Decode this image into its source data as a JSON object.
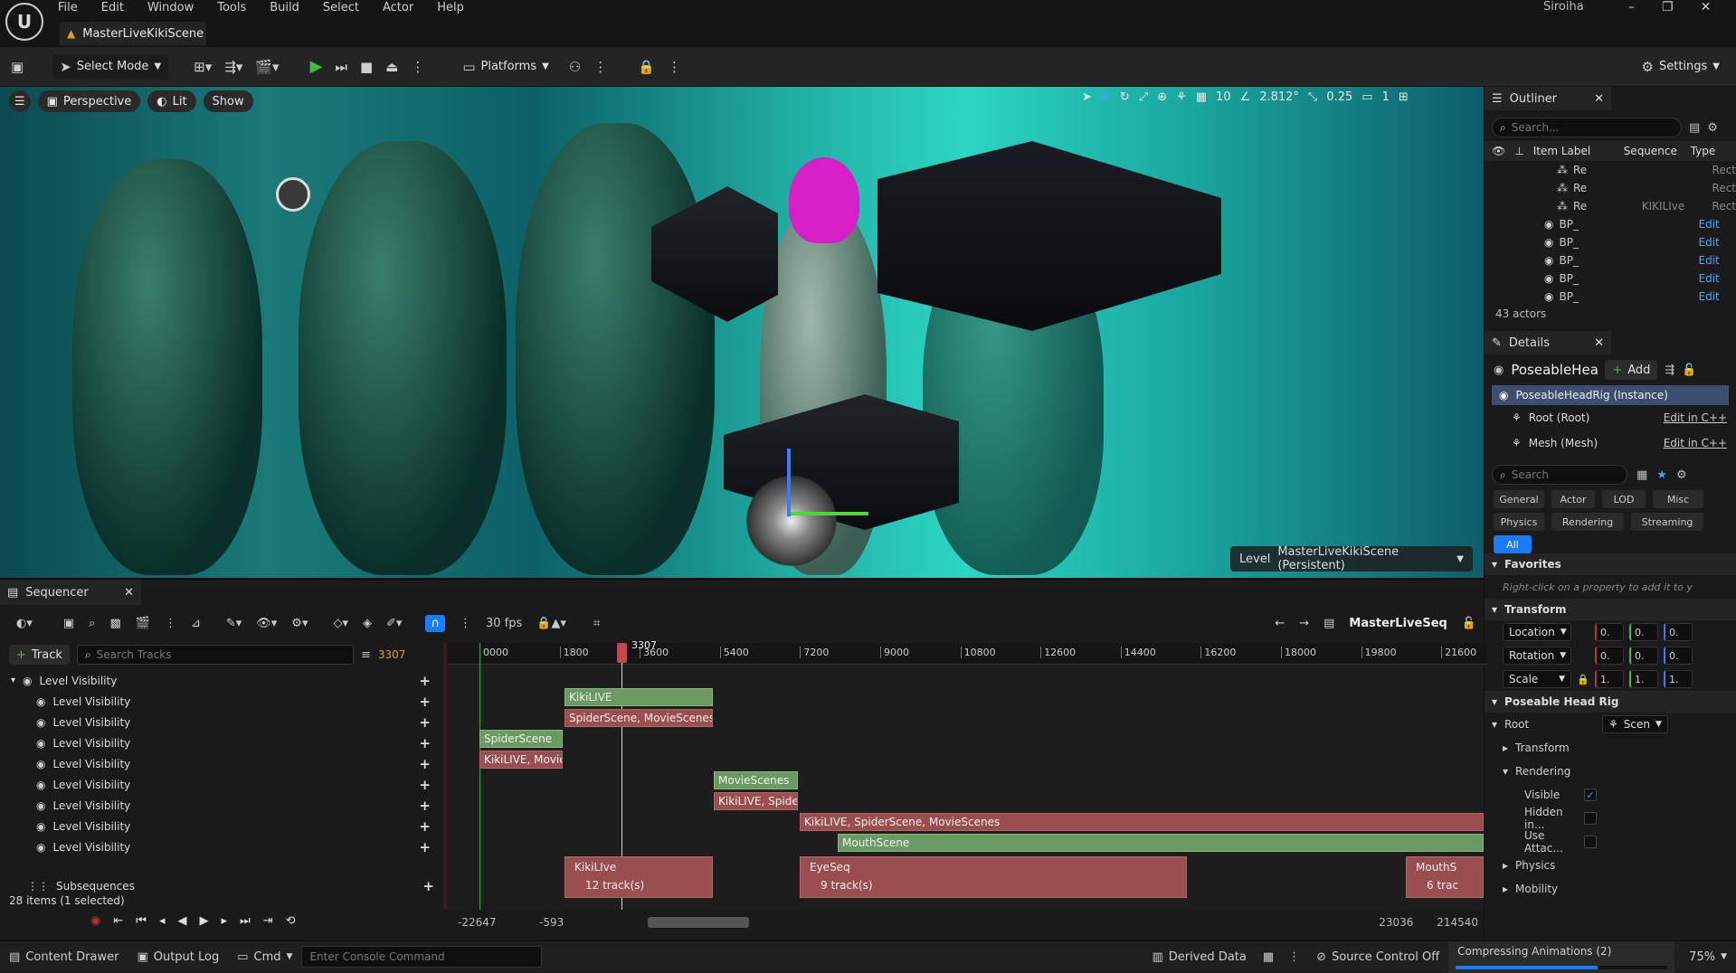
{
  "app": {
    "logo": "U",
    "document_tab": "MasterLiveKikiScene",
    "user": "Siroiha"
  },
  "menu": [
    "File",
    "Edit",
    "Window",
    "Tools",
    "Build",
    "Select",
    "Actor",
    "Help"
  ],
  "window_controls": [
    "–",
    "❐",
    "✕"
  ],
  "toolbar": {
    "select_mode": "Select Mode",
    "platforms": "Platforms",
    "settings": "Settings"
  },
  "viewport": {
    "perspective": "Perspective",
    "lit": "Lit",
    "show": "Show",
    "grid": "10",
    "angle": "2.812°",
    "scale": "0.25",
    "camera_speed": "1",
    "level_label": "Level",
    "level_name": "MasterLiveKikiScene (Persistent)"
  },
  "outliner": {
    "title": "Outliner",
    "search_placeholder": "Search...",
    "columns": {
      "label": "Item Label",
      "sequence": "Sequence",
      "type": "Type"
    },
    "rows": [
      {
        "name": "Re",
        "sequence": "",
        "type": "Rect",
        "edit": false
      },
      {
        "name": "Re",
        "sequence": "",
        "type": "Rect",
        "edit": false
      },
      {
        "name": "Re",
        "sequence": "KIKILIve",
        "type": "Rect",
        "edit": false
      },
      {
        "name": "BP_",
        "sequence": "",
        "type": "Edit",
        "edit": true
      },
      {
        "name": "BP_",
        "sequence": "",
        "type": "Edit",
        "edit": true
      },
      {
        "name": "BP_",
        "sequence": "",
        "type": "Edit",
        "edit": true
      },
      {
        "name": "BP_",
        "sequence": "",
        "type": "Edit",
        "edit": true
      },
      {
        "name": "BP_",
        "sequence": "",
        "type": "Edit",
        "edit": true
      }
    ],
    "count": "43 actors"
  },
  "details": {
    "title": "Details",
    "object": "PoseableHeac",
    "add": "Add",
    "instance": "PoseableHeadRig (Instance)",
    "components": [
      {
        "name": "Root (Root)",
        "link": "Edit in C++"
      },
      {
        "name": "Mesh (Mesh)",
        "link": "Edit in C++"
      }
    ],
    "search_placeholder": "Search",
    "categories": [
      "General",
      "Actor",
      "LOD",
      "Misc",
      "Physics",
      "Rendering",
      "Streaming",
      "All"
    ],
    "favorites": "Favorites",
    "favorites_hint": "Right-click on a property to add it to y",
    "transform": "Transform",
    "transform_rows": [
      {
        "label": "Location",
        "x": "0.",
        "y": "0.",
        "z": "0."
      },
      {
        "label": "Rotation",
        "x": "0.",
        "y": "0.",
        "z": "0."
      },
      {
        "label": "Scale",
        "x": "1.",
        "y": "1.",
        "z": "1."
      }
    ],
    "poseable_section": "Poseable Head Rig",
    "root": "Root",
    "root_value": "Scen",
    "sub_transform": "Transform",
    "rendering": "Rendering",
    "visible": "Visible",
    "hidden": "Hidden in...",
    "use_attach": "Use Attac...",
    "physics": "Physics",
    "mobility": "Mobility"
  },
  "sequencer": {
    "title": "Sequencer",
    "fps": "30 fps",
    "sequence_name": "MasterLiveSeq",
    "track_button": "Track",
    "search_placeholder": "Search Tracks",
    "current_frame": "3307",
    "playhead": "3307",
    "ruler": [
      "0000",
      "1800",
      "3600",
      "5400",
      "7200",
      "9000",
      "10800",
      "12600",
      "14400",
      "16200",
      "18000",
      "19800",
      "21600"
    ],
    "tracks": {
      "root": "Level Visibility",
      "children": [
        "Level Visibility",
        "Level Visibility",
        "Level Visibility",
        "Level Visibility",
        "Level Visibility",
        "Level Visibility",
        "Level Visibility",
        "Level Visibility"
      ]
    },
    "subsequences": "Subsequences",
    "items": "28 items (1 selected)",
    "clips": {
      "c1": "KikiLIVE",
      "c2": "SpiderScene, MovieScenes,",
      "c3": "SpiderScene",
      "c4": "KikiLIVE, Movie",
      "c5": "MovieScenes",
      "c6": "KikiLIVE, Spider",
      "c7": "KikiLIVE, SpiderScene, MovieScenes",
      "c8": "MouthScene"
    },
    "subclips": [
      {
        "name": "KikiLIve",
        "tracks": "12 track(s)"
      },
      {
        "name": "EyeSeq",
        "tracks": "9 track(s)"
      },
      {
        "name": "MouthS",
        "tracks": "6 trac"
      }
    ],
    "range": {
      "start": "-22647",
      "in": "-593",
      "out": "23036",
      "end": "214540"
    }
  },
  "status": {
    "content_drawer": "Content Drawer",
    "output_log": "Output Log",
    "cmd": "Cmd",
    "console_placeholder": "Enter Console Command",
    "derived_data": "Derived Data",
    "source_control": "Source Control Off",
    "compressing": "Compressing Animations (2)",
    "progress": 0.67,
    "zoom": "75%"
  }
}
